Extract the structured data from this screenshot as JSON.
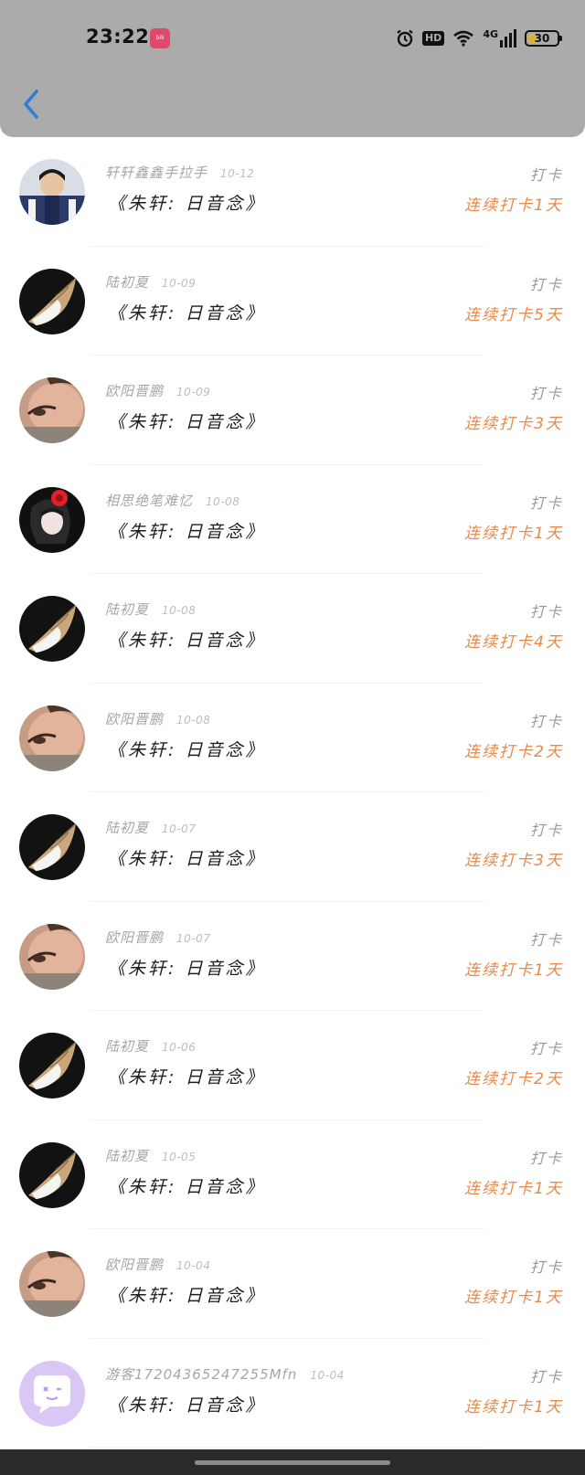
{
  "status_bar": {
    "time": "23:22",
    "app_icon": "bilibili-icon",
    "battery": "30",
    "battery_level": 0.3
  },
  "header": {
    "back_icon": "chevron-left-icon",
    "accent": "#2a7fd6"
  },
  "colors": {
    "streak": "#e88a4a",
    "name": "#a6a6a6",
    "header_bg": "#ababab"
  },
  "list": [
    {
      "avatar": "portrait-boy",
      "name": "轩轩鑫鑫手拉手",
      "date": "10-12",
      "title": "《朱轩: 日音念》",
      "label": "打卡",
      "streak": "连续打卡1天"
    },
    {
      "avatar": "conch-shell",
      "name": "陆初夏",
      "date": "10-09",
      "title": "《朱轩: 日音念》",
      "label": "打卡",
      "streak": "连续打卡5天"
    },
    {
      "avatar": "face-closeup",
      "name": "欧阳晋鹏",
      "date": "10-09",
      "title": "《朱轩: 日音念》",
      "label": "打卡",
      "streak": "连续打卡3天"
    },
    {
      "avatar": "girl-rose",
      "name": "相思绝笔难忆",
      "date": "10-08",
      "title": "《朱轩: 日音念》",
      "label": "打卡",
      "streak": "连续打卡1天"
    },
    {
      "avatar": "conch-shell",
      "name": "陆初夏",
      "date": "10-08",
      "title": "《朱轩: 日音念》",
      "label": "打卡",
      "streak": "连续打卡4天"
    },
    {
      "avatar": "face-closeup",
      "name": "欧阳晋鹏",
      "date": "10-08",
      "title": "《朱轩: 日音念》",
      "label": "打卡",
      "streak": "连续打卡2天"
    },
    {
      "avatar": "conch-shell",
      "name": "陆初夏",
      "date": "10-07",
      "title": "《朱轩: 日音念》",
      "label": "打卡",
      "streak": "连续打卡3天"
    },
    {
      "avatar": "face-closeup",
      "name": "欧阳晋鹏",
      "date": "10-07",
      "title": "《朱轩: 日音念》",
      "label": "打卡",
      "streak": "连续打卡1天"
    },
    {
      "avatar": "conch-shell",
      "name": "陆初夏",
      "date": "10-06",
      "title": "《朱轩: 日音念》",
      "label": "打卡",
      "streak": "连续打卡2天"
    },
    {
      "avatar": "conch-shell",
      "name": "陆初夏",
      "date": "10-05",
      "title": "《朱轩: 日音念》",
      "label": "打卡",
      "streak": "连续打卡1天"
    },
    {
      "avatar": "face-closeup",
      "name": "欧阳晋鹏",
      "date": "10-04",
      "title": "《朱轩: 日音念》",
      "label": "打卡",
      "streak": "连续打卡1天"
    },
    {
      "avatar": "default-chat-bubble",
      "name": "游客1720436524725​5Mfn",
      "date": "10-04",
      "title": "《朱轩: 日音念》",
      "label": "打卡",
      "streak": "连续打卡1天"
    }
  ]
}
